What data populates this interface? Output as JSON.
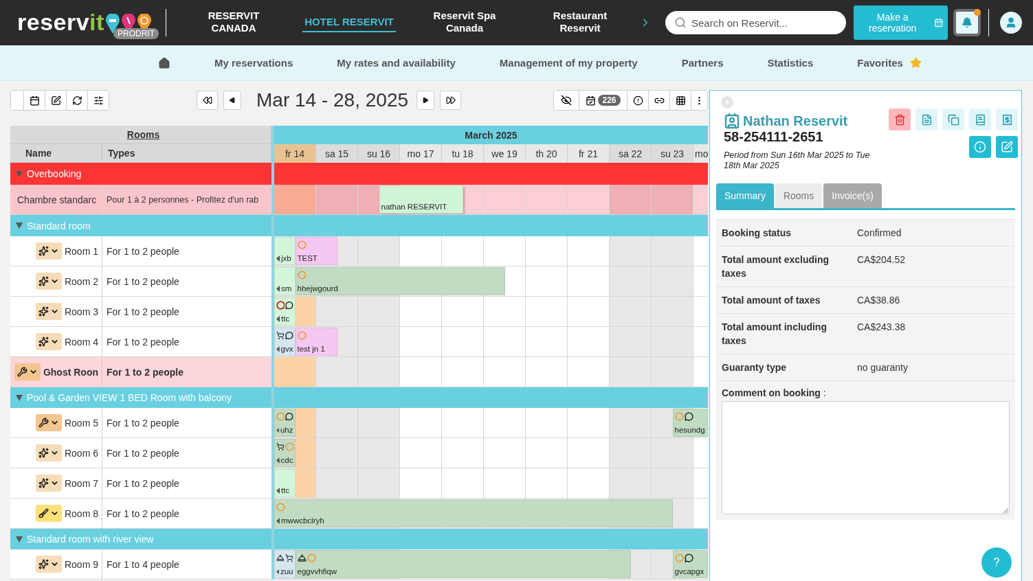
{
  "topbar": {
    "logo": {
      "name": "reserv",
      "accent": "it",
      "badge": "PRODRIT"
    },
    "nav": [
      {
        "label": "RESERVIT CANADA",
        "selected": false
      },
      {
        "label": "HOTEL RESERVIT",
        "selected": true
      },
      {
        "label": "Reservit Spa Canada",
        "selected": false
      },
      {
        "label": "Restaurant Reservit",
        "selected": false
      }
    ],
    "search": {
      "placeholder": "Search on Reservit..."
    },
    "reserve_button": "Make a reservation",
    "notifications": {
      "unread": true
    }
  },
  "menu": [
    {
      "kind": "home"
    },
    {
      "kind": "link",
      "label": "My reservations"
    },
    {
      "kind": "link",
      "label": "My rates and availability"
    },
    {
      "kind": "link",
      "label": "Management of my property"
    },
    {
      "kind": "link",
      "label": "Partners"
    },
    {
      "kind": "link",
      "label": "Statistics"
    },
    {
      "kind": "favorite",
      "label": "Favorites"
    }
  ],
  "toolbar": {
    "date_range": "Mar 14 - 28, 2025",
    "count_badge": "226"
  },
  "planning": {
    "rooms_header": "Rooms",
    "columns": [
      "Name",
      "Types"
    ],
    "month": "March 2025",
    "days": [
      {
        "label": "fr 14",
        "today": true,
        "weekend": false
      },
      {
        "label": "sa 15",
        "today": false,
        "weekend": true
      },
      {
        "label": "su 16",
        "today": false,
        "weekend": true
      },
      {
        "label": "mo 17",
        "today": false,
        "weekend": false
      },
      {
        "label": "tu 18",
        "today": false,
        "weekend": false
      },
      {
        "label": "we 19",
        "today": false,
        "weekend": false
      },
      {
        "label": "th 20",
        "today": false,
        "weekend": false
      },
      {
        "label": "fr 21",
        "today": false,
        "weekend": false
      },
      {
        "label": "sa 22",
        "today": false,
        "weekend": true
      },
      {
        "label": "su 23",
        "today": false,
        "weekend": true
      },
      {
        "label": "mo",
        "today": false,
        "weekend": false
      }
    ],
    "groups": [
      {
        "kind": "alert",
        "name": "Overbooking",
        "expanded": true,
        "rows": [
          {
            "kind": "overbooking",
            "name": "Chambre standarc",
            "type": "Pour 1 à 2 personnes - Profitez d'un rab",
            "bookings": [
              {
                "label": "nathan RESERVIT",
                "color": "#d2f5d8",
                "continued": false
              }
            ]
          }
        ]
      },
      {
        "kind": "category",
        "name": "Standard room",
        "expanded": true,
        "rows": [
          {
            "kind": "room",
            "status": {
              "kind": "clean"
            },
            "name": "Room 1",
            "type": "For 1 to 2 people",
            "today_free": false,
            "bookings": [
              {
                "label": "jxb",
                "color": "#d3f5da",
                "continued": true
              },
              {
                "label": "TEST",
                "color": "#f5c8f2",
                "continued": false,
                "icons": [
                  {
                    "kind": "status"
                  }
                ]
              }
            ]
          },
          {
            "kind": "room",
            "status": {
              "kind": "clean"
            },
            "name": "Room 2",
            "type": "For 1 to 2 people",
            "today_free": false,
            "bookings": [
              {
                "label": "sm",
                "color": "#d3f5da",
                "continued": true
              },
              {
                "label": "hhejwgourd",
                "color": "#c2dbc3",
                "continued": false,
                "icons": [
                  {
                    "kind": "status"
                  }
                ]
              }
            ]
          },
          {
            "kind": "room",
            "status": {
              "kind": "clean"
            },
            "name": "Room 3",
            "type": "For 1 to 2 people",
            "today_free": true,
            "bookings": [
              {
                "label": "ttc",
                "color": "#d3f5da",
                "continued": true,
                "icons": [
                  {
                    "kind": "alert"
                  },
                  {
                    "kind": "note"
                  }
                ]
              }
            ]
          },
          {
            "kind": "room",
            "status": {
              "kind": "clean"
            },
            "name": "Room 4",
            "type": "For 1 to 2 people",
            "today_free": false,
            "bookings": [
              {
                "label": "gvx",
                "color": "#d5e6ee",
                "continued": true,
                "icons": [
                  {
                    "kind": "cart"
                  },
                  {
                    "kind": "note"
                  }
                ]
              },
              {
                "label": "test jn 1",
                "color": "#f5c8f2",
                "continued": false,
                "icons": [
                  {
                    "kind": "status"
                  }
                ]
              }
            ]
          },
          {
            "kind": "ghost",
            "status": {
              "kind": "repair"
            },
            "name": "Ghost Roon",
            "type": "For 1 to 2 people"
          }
        ]
      },
      {
        "kind": "category",
        "name": "Pool & Garden VIEW 1 BED Room with balcony",
        "expanded": true,
        "rows": [
          {
            "kind": "room",
            "status": {
              "kind": "repair"
            },
            "name": "Room 5",
            "type": "For 1 to 2 people",
            "today_free": true,
            "bookings": [
              {
                "label": "uhz",
                "color": "#c2dbc3",
                "continued": true,
                "icons": [
                  {
                    "kind": "status"
                  },
                  {
                    "kind": "note"
                  }
                ]
              },
              {
                "label": "hesundg",
                "color": "#c2dbc3",
                "continued": false,
                "icons": [
                  {
                    "kind": "status"
                  },
                  {
                    "kind": "note"
                  }
                ]
              }
            ]
          },
          {
            "kind": "room",
            "status": {
              "kind": "clean"
            },
            "name": "Room 6",
            "type": "For 1 to 2 people",
            "today_free": true,
            "bookings": [
              {
                "label": "cdc",
                "color": "#c2dbc3",
                "continued": true,
                "icons": [
                  {
                    "kind": "cart"
                  },
                  {
                    "kind": "status"
                  }
                ]
              }
            ]
          },
          {
            "kind": "room",
            "status": {
              "kind": "clean"
            },
            "name": "Room 7",
            "type": "For 1 to 2 people",
            "today_free": true,
            "bookings": [
              {
                "label": "ttc",
                "color": "#d3f5da",
                "continued": true
              }
            ]
          },
          {
            "kind": "room",
            "status": {
              "kind": "dusting"
            },
            "name": "Room 8",
            "type": "For 1 to 2 people",
            "today_free": false,
            "bookings": [
              {
                "label": "mwwcbclryh",
                "color": "#c2dbc3",
                "continued": true,
                "icons": [
                  {
                    "kind": "status"
                  }
                ]
              }
            ]
          }
        ]
      },
      {
        "kind": "category",
        "name": "Standard room with river view",
        "expanded": true,
        "rows": [
          {
            "kind": "room",
            "status": {
              "kind": "clean"
            },
            "name": "Room 9",
            "type": "For 1 to 4 people",
            "today_free": false,
            "bookings": [
              {
                "label": "zuu",
                "color": "#d5e6ee",
                "continued": true,
                "icons": [
                  {
                    "kind": "service"
                  },
                  {
                    "kind": "cart"
                  }
                ]
              },
              {
                "label": "eggvvhfiqw",
                "color": "#c2dbc3",
                "continued": false,
                "icons": [
                  {
                    "kind": "service"
                  },
                  {
                    "kind": "status"
                  }
                ]
              },
              {
                "label": "gvcapgx",
                "color": "#c2dbc3",
                "continued": false,
                "icons": [
                  {
                    "kind": "status"
                  },
                  {
                    "kind": "note"
                  }
                ]
              }
            ]
          }
        ]
      }
    ]
  },
  "details": {
    "guest": "Nathan Reservit",
    "reference": "58-254111-2651",
    "period": "Period from Sun 16th Mar 2025 to Tue 18th Mar 2025",
    "tabs": [
      {
        "label": "Summary",
        "selected": true
      },
      {
        "label": "Rooms",
        "selected": false
      },
      {
        "label": "Invoice(s)",
        "selected": false
      }
    ],
    "fields": [
      {
        "label": "Booking status",
        "value": "Confirmed"
      },
      {
        "label": "Total amount excluding taxes",
        "value": "CA$204.52"
      },
      {
        "label": "Total amount of taxes",
        "value": "CA$38.86"
      },
      {
        "label": "Total amount including taxes",
        "value": "CA$243.38"
      },
      {
        "label": "Guaranty type",
        "value": "no guaranty"
      }
    ],
    "comment_label": "**Comment on booking** :",
    "help": "?"
  }
}
